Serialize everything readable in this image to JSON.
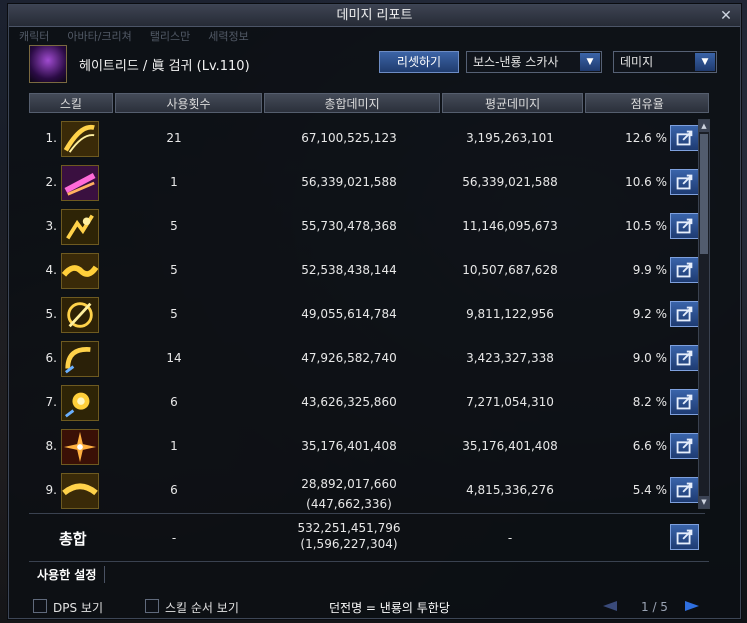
{
  "window": {
    "title": "데미지 리포트"
  },
  "background_tabs": [
    "캐릭터",
    "아바타/크리쳐",
    "탤리스만",
    "세력정보"
  ],
  "character": {
    "name": "헤이트리드 / 眞 검귀 (Lv.110)"
  },
  "controls": {
    "reset_label": "리셋하기",
    "target_value": "보스-낸룡 스카사",
    "metric_value": "데미지"
  },
  "table": {
    "headers": {
      "skill": "스킬",
      "count": "사용횟수",
      "total": "총합데미지",
      "avg": "평균데미지",
      "share": "점유율"
    },
    "rows": [
      {
        "rank": "1.",
        "icon": "golden-slash-skill-icon",
        "count": "21",
        "total": "67,100,525,123",
        "avg": "3,195,263,101",
        "share": "12.6 %"
      },
      {
        "rank": "2.",
        "icon": "purple-fire-slash-skill-icon",
        "count": "1",
        "total": "56,339,021,588",
        "avg": "56,339,021,588",
        "share": "10.6 %"
      },
      {
        "rank": "3.",
        "icon": "golden-dragon-skill-icon",
        "count": "5",
        "total": "55,730,478,368",
        "avg": "11,146,095,673",
        "share": "10.5 %"
      },
      {
        "rank": "4.",
        "icon": "golden-wave-skill-icon",
        "count": "5",
        "total": "52,538,438,144",
        "avg": "10,507,687,628",
        "share": "9.9 %"
      },
      {
        "rank": "5.",
        "icon": "golden-cross-slash-skill-icon",
        "count": "5",
        "total": "49,055,614,784",
        "avg": "9,811,122,956",
        "share": "9.2 %"
      },
      {
        "rank": "6.",
        "icon": "golden-whirl-skill-icon",
        "count": "14",
        "total": "47,926,582,740",
        "avg": "3,423,327,338",
        "share": "9.0 %"
      },
      {
        "rank": "7.",
        "icon": "golden-burst-skill-icon",
        "count": "6",
        "total": "43,626,325,860",
        "avg": "7,271,054,310",
        "share": "8.2 %"
      },
      {
        "rank": "8.",
        "icon": "crimson-star-skill-icon",
        "count": "1",
        "total": "35,176,401,408",
        "avg": "35,176,401,408",
        "share": "6.6 %"
      },
      {
        "rank": "9.",
        "icon": "golden-arc-skill-icon",
        "count": "6",
        "total": "28,892,017,660",
        "total_sub": "(447,662,336)",
        "avg": "4,815,336,276",
        "share": "5.4 %"
      }
    ],
    "summary": {
      "label": "총합",
      "count": "-",
      "total": "532,251,451,796",
      "total_sub": "(1,596,227,304)",
      "avg": "-"
    }
  },
  "settings": {
    "label": "사용한 설정"
  },
  "footer": {
    "dps_label": "DPS 보기",
    "skill_order_label": "스킬 순서 보기",
    "dungeon_text": "던전명 = 낸룡의 투한당",
    "page_text": "1 / 5"
  },
  "colors": {
    "accent_blue": "#3a64aa",
    "header_bg": "#2b303b",
    "icon_gold": "#f0c040"
  }
}
